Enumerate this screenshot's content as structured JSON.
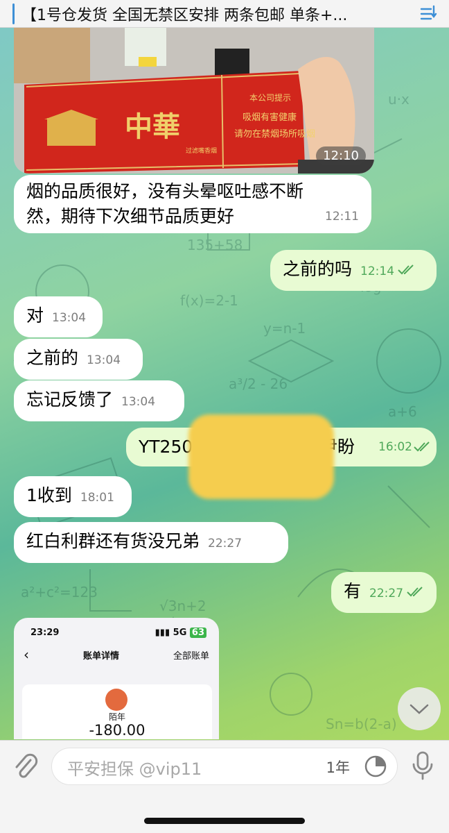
{
  "pinned": {
    "text": "【1号仓发货 全国无禁区安排 两条包邮 单条+..."
  },
  "photo": {
    "time": "12:10",
    "brand": "中華",
    "sub_brand": "过滤嘴香烟",
    "warning_1": "本公司提示",
    "warning_2": "吸烟有害健康",
    "warning_3": "请勿在禁烟场所吸烟"
  },
  "messages": [
    {
      "text": "烟的品质很好，没有头晕呕吐感不断",
      "text2": "然，期待下次细节品质更好",
      "time": "12:11",
      "dir": "in"
    },
    {
      "text": "之前的吗",
      "time": "12:14",
      "dir": "out"
    },
    {
      "text": "对",
      "time": "13:04",
      "dir": "in"
    },
    {
      "text": "之前的",
      "time": "13:04",
      "dir": "in"
    },
    {
      "text": "忘记反馈了",
      "time": "13:04",
      "dir": "in"
    },
    {
      "text": "YT2500",
      "text_tail": "尹盼",
      "time": "16:02",
      "dir": "out"
    },
    {
      "text": "1收到",
      "time": "18:01",
      "dir": "in"
    },
    {
      "text": "红白利群还有货没兄弟",
      "time": "22:27",
      "dir": "in"
    },
    {
      "text": "有",
      "time": "22:27",
      "dir": "out"
    }
  ],
  "screenshot_preview": {
    "status_time": "23:29",
    "network": "5G",
    "battery": "63",
    "title": "账单详情",
    "right_link": "全部账单",
    "merchant": "陌年",
    "amount": "-180.00"
  },
  "composer": {
    "placeholder": "平安担保 @vip11",
    "timer_label": "1年"
  },
  "colors": {
    "outgoing_bubble": "#e8fbd3",
    "incoming_bubble": "#ffffff",
    "read_check": "#4fa85a",
    "redaction": "#f5cd4e"
  }
}
